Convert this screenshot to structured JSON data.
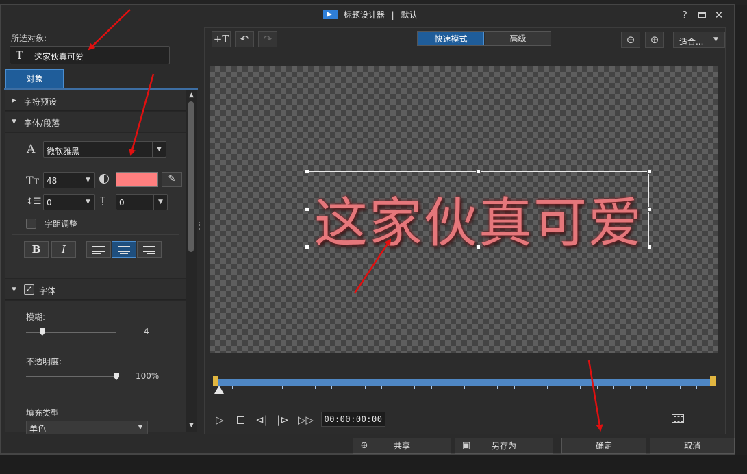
{
  "window": {
    "title": "标题设计器",
    "separator": "|",
    "preset": "默认",
    "help_glyph": "?",
    "close_glyph": "✕"
  },
  "left_panel": {
    "selected_label": "所选对象:",
    "object_type_icon": "T",
    "object_name": "这家伙真可爱",
    "tab_label": "对象",
    "sections": {
      "char_preset": "字符预设",
      "font_paragraph": "字体/段落",
      "font_effect": "字体"
    },
    "font": {
      "icon": "A",
      "family": "微软雅黑",
      "size": "48",
      "color": "#ff7f7f",
      "line_spacing": "0",
      "char_spacing": "0",
      "kerning_label": "字距调整"
    },
    "format": {
      "bold": "B",
      "italic": "I"
    },
    "effect": {
      "blur_label": "模糊:",
      "blur_value": "4",
      "blur_fraction": 0.18,
      "opacity_label": "不透明度:",
      "opacity_value": "100%",
      "opacity_fraction": 1.0,
      "fill_type_label": "填充类型",
      "fill_type_value": "单色"
    }
  },
  "preview": {
    "mode_fast": "快速模式",
    "mode_advanced": "高级",
    "fit_label": "适合...",
    "title_text": "这家伙真可爱",
    "title_color": "#e5777b",
    "timecode": "00:00:00:00"
  },
  "buttons": {
    "share": "共享",
    "save_as": "另存为",
    "ok": "确定",
    "cancel": "取消"
  },
  "annotations": {
    "arrow_color": "#e01010"
  }
}
